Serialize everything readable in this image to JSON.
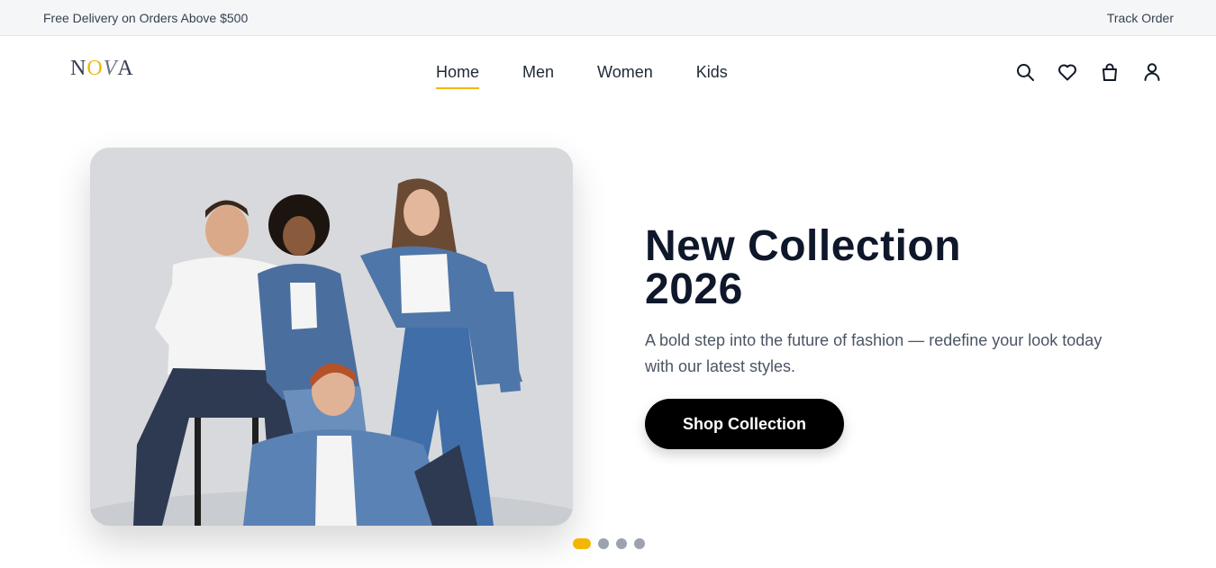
{
  "topbar": {
    "promo_text": "Free Delivery on Orders Above $500",
    "track_order_label": "Track Order"
  },
  "header": {
    "logo": {
      "letters": [
        "N",
        "O",
        "V",
        "A"
      ],
      "accent_color": "#f2b705"
    },
    "nav": [
      {
        "label": "Home",
        "active": true
      },
      {
        "label": "Men",
        "active": false
      },
      {
        "label": "Women",
        "active": false
      },
      {
        "label": "Kids",
        "active": false
      }
    ],
    "icons": [
      "search-icon",
      "heart-icon",
      "bag-icon",
      "user-icon"
    ]
  },
  "hero": {
    "title_line1": "New Collection",
    "title_line2": "2026",
    "description": "A bold step into the future of fashion — redefine your look today with our latest styles.",
    "cta_label": "Shop Collection",
    "image": "group-of-four-models-in-denim"
  },
  "carousel": {
    "slide_count": 4,
    "active_index": 0
  },
  "colors": {
    "accent": "#f2b705",
    "cta_background": "#000000",
    "title": "#0f172a",
    "inactive_dot": "#9ca3af"
  }
}
